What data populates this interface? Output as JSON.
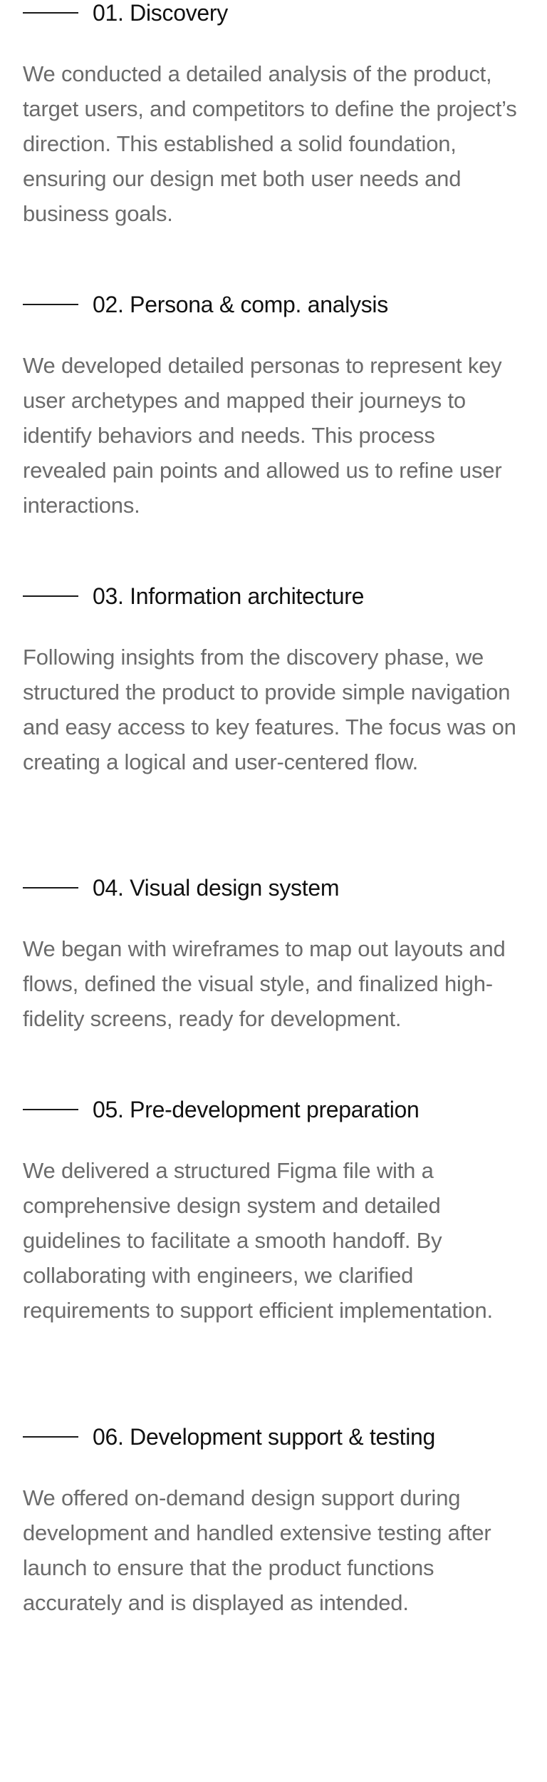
{
  "steps": [
    {
      "title": "01. Discovery",
      "body": "We conducted a detailed analysis of the product, target users, and competitors to define the project’s direction. This established a solid foundation, ensuring our design met both user needs and business goals."
    },
    {
      "title": "02. Persona & comp. analysis",
      "body": "We developed detailed personas to represent key user archetypes and mapped their journeys to identify behaviors and needs. This process revealed pain points and allowed us to refine user interactions."
    },
    {
      "title": "03. Information architecture",
      "body": "Following insights from the discovery phase, we structured the product to provide simple navigation and easy access to key features. The focus was on creating a logical and user-centered flow."
    },
    {
      "title": "04. Visual design system",
      "body": "We began with wireframes to map out layouts and flows, defined the visual style, and finalized high-fidelity screens, ready for development."
    },
    {
      "title": "05. Pre-development preparation",
      "body": "We delivered a structured Figma file with a comprehensive design system and detailed guidelines to facilitate a smooth handoff. By collaborating with engineers, we clarified requirements to support efficient implementation."
    },
    {
      "title": "06. Development support & testing",
      "body": "We offered on-demand design support during development and handled extensive testing after launch to ensure that the product functions accurately and is displayed as intended."
    }
  ]
}
